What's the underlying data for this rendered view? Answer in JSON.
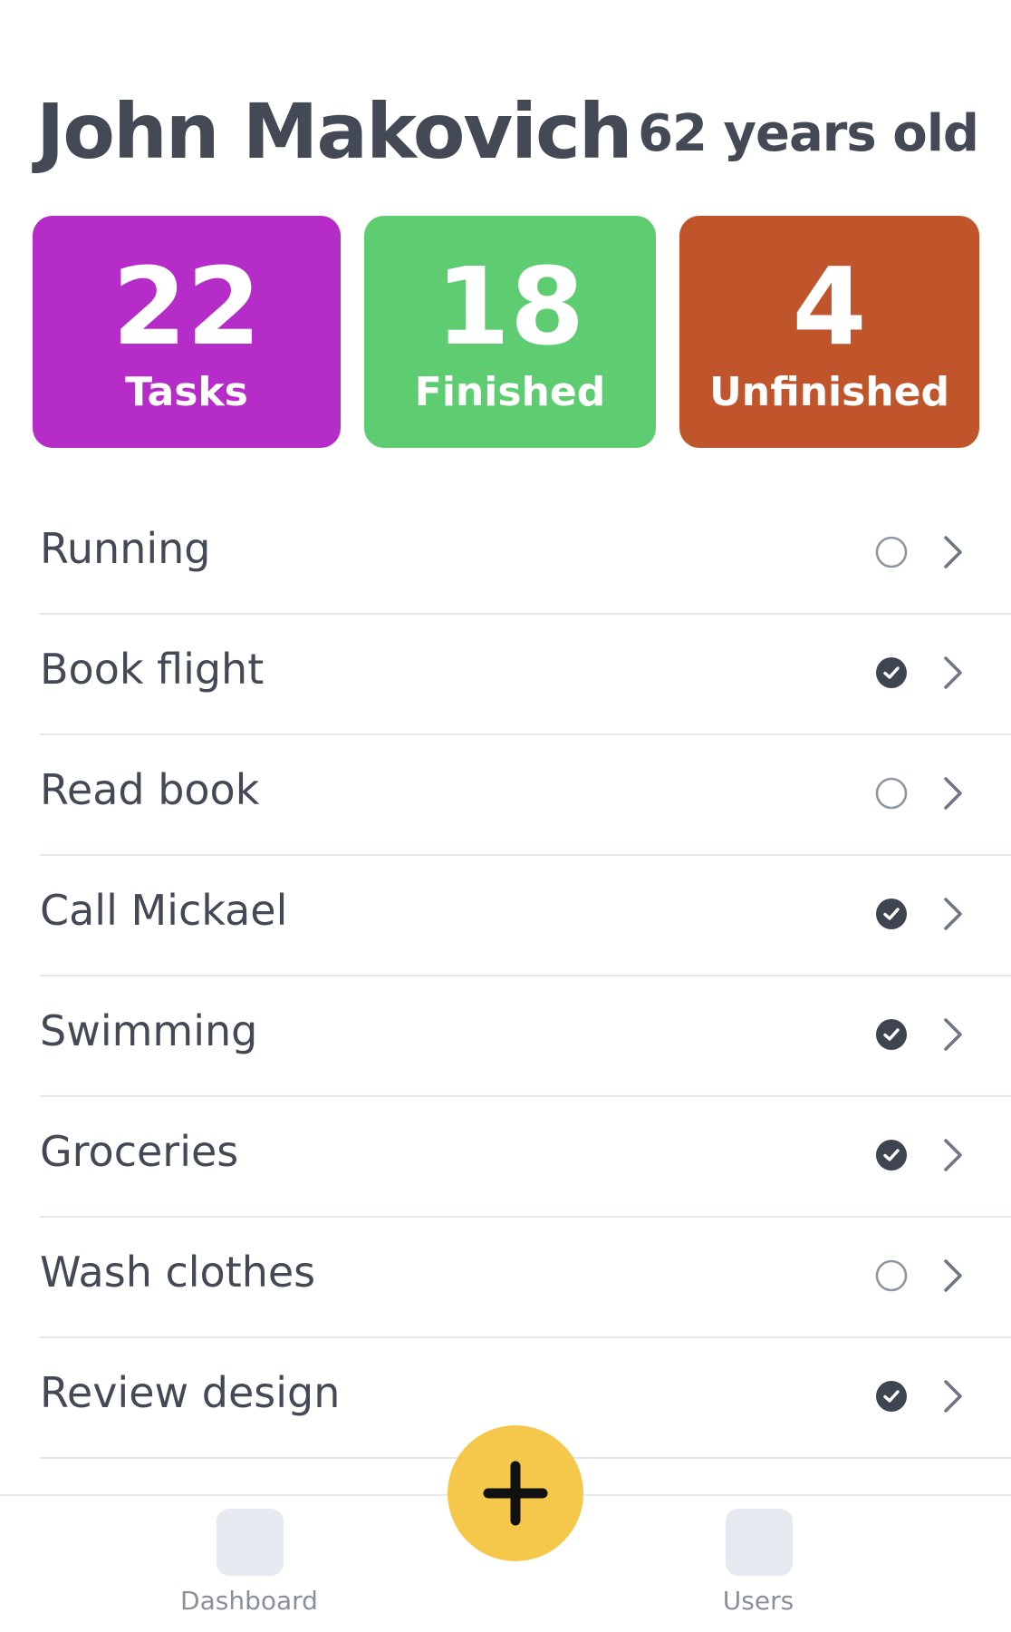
{
  "profile": {
    "name": "John Makovich",
    "age": "62 years old"
  },
  "stats": [
    {
      "value": "22",
      "label": "Tasks",
      "color": "#b52cc8"
    },
    {
      "value": "18",
      "label": "Finished",
      "color": "#5ecd71"
    },
    {
      "value": "4",
      "label": "Unfinished",
      "color": "#c0552c"
    }
  ],
  "tasks": [
    {
      "label": "Running",
      "done": false
    },
    {
      "label": "Book flight",
      "done": true
    },
    {
      "label": "Read book",
      "done": false
    },
    {
      "label": "Call Mickael",
      "done": true
    },
    {
      "label": "Swimming",
      "done": true
    },
    {
      "label": "Groceries",
      "done": true
    },
    {
      "label": "Wash clothes",
      "done": false
    },
    {
      "label": "Review design",
      "done": true
    }
  ],
  "tabbar": {
    "dashboard_label": "Dashboard",
    "users_label": "Users",
    "add_icon": "plus-icon",
    "fab_color": "#f5c84c"
  },
  "icons": {
    "done": "check-circle-icon",
    "pending": "empty-circle-icon",
    "chevron": "chevron-right-icon"
  }
}
